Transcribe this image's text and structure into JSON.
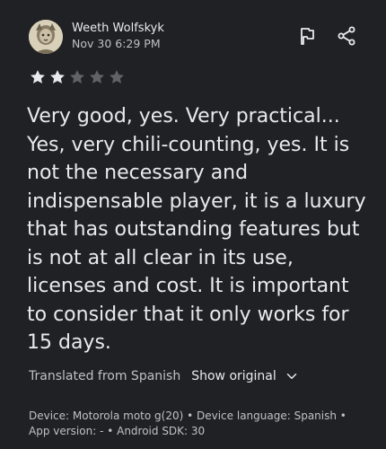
{
  "review": {
    "reviewer_name": "Weeth Wolfskyk",
    "date": "Nov 30 6:29 PM",
    "rating": 2,
    "max_rating": 5,
    "text": "Very good, yes. Very practical... Yes, very chili-counting, yes. It is not the necessary and indispensable player, it is a luxury that has outstanding features but is not at all clear in its use, licenses and cost. It is important to consider that it only works for 15 days."
  },
  "actions": {
    "flag_icon": "flag-icon",
    "share_icon": "share-icon"
  },
  "translation": {
    "label": "Translated from Spanish",
    "show_original_label": "Show original",
    "chevron_icon": "chevron-down-icon"
  },
  "device_info": {
    "line1": "Device: Motorola moto g(20) • Device language: Spanish •",
    "line2": "App version: - • Android SDK: 30"
  },
  "colors": {
    "background": "#202124",
    "star_filled": "#e8eaed",
    "star_empty": "#5f6368",
    "text_primary": "#e8eaed",
    "text_secondary": "#bdc1c6"
  }
}
